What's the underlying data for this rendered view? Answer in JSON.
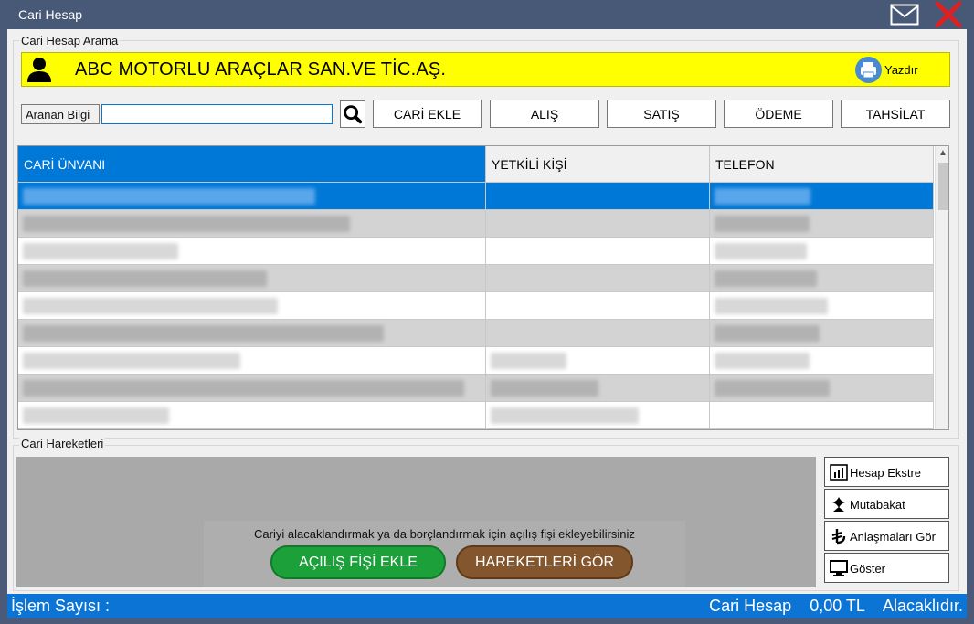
{
  "window": {
    "title": "Cari Hesap"
  },
  "search_group": {
    "label": "Cari Hesap Arama"
  },
  "banner": {
    "customer_name": "ABC MOTORLU ARAÇLAR SAN.VE TİC.AŞ.",
    "print_label": "Yazdır",
    "background": "#ffff00"
  },
  "search": {
    "label": "Aranan Bilgi",
    "value": "",
    "icon": "search-icon"
  },
  "toolbar": {
    "add_label": "CARİ EKLE",
    "purchase_label": "ALIŞ",
    "sales_label": "SATIŞ",
    "payment_label": "ÖDEME",
    "collection_label": "TAHSİLAT"
  },
  "grid": {
    "columns": [
      "CARİ ÜNVANI",
      "YETKİLİ KİŞİ",
      "TELEFON"
    ],
    "selected_row": 0,
    "note": ""
  },
  "moves_group": {
    "label": "Cari Hareketleri",
    "message": "Cariyi alacaklandırmak ya da borçlandırmak için açılış fişi ekleyebilirsiniz",
    "open_label": "AÇILIŞ FİŞİ EKLE",
    "see_label": "HAREKETLERİ GÖR"
  },
  "side_buttons": {
    "statement": "Hesap Ekstre",
    "reconciliation": "Mutabakat",
    "agreements": "Anlaşmaları Gör",
    "show": "Göster"
  },
  "status": {
    "count_label": "İşlem Sayısı :",
    "account_label": "Cari Hesap",
    "balance": "0,00 TL",
    "balance_state": "Alacaklıdır."
  },
  "colors": {
    "accent": "#0b74d4",
    "selected_row": "#0078d7",
    "green": "#1ca03a",
    "brown": "#83562d"
  }
}
